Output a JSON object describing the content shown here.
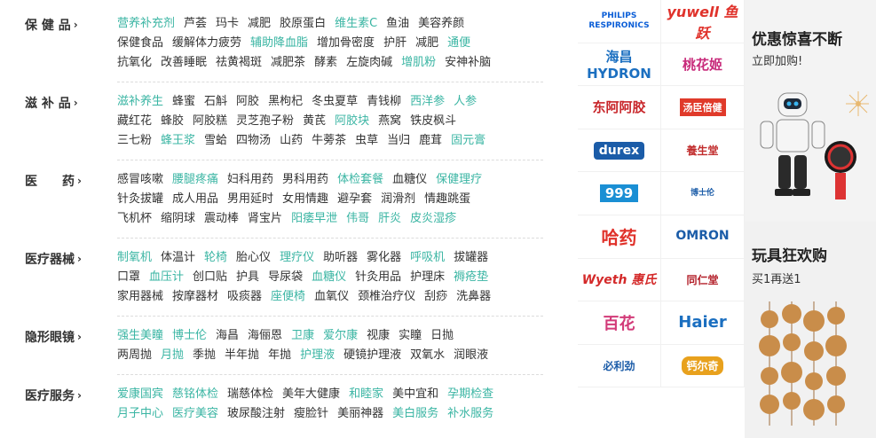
{
  "categories": [
    {
      "title": "保 健 品",
      "lines": [
        [
          {
            "t": "营养补充剂",
            "h": true
          },
          {
            "t": "芦荟"
          },
          {
            "t": "玛卡"
          },
          {
            "t": "减肥"
          },
          {
            "t": "胶原蛋白"
          },
          {
            "t": "维生素C",
            "h": true
          },
          {
            "t": "鱼油"
          },
          {
            "t": "美容养颜"
          }
        ],
        [
          {
            "t": "保健食品"
          },
          {
            "t": "缓解体力疲劳"
          },
          {
            "t": "辅助降血脂",
            "h": true
          },
          {
            "t": "增加骨密度"
          },
          {
            "t": "护肝"
          },
          {
            "t": "减肥"
          },
          {
            "t": "通便",
            "h": true
          }
        ],
        [
          {
            "t": "抗氧化"
          },
          {
            "t": "改善睡眠"
          },
          {
            "t": "祛黄褐斑"
          },
          {
            "t": "减肥茶"
          },
          {
            "t": "酵素"
          },
          {
            "t": "左旋肉碱"
          },
          {
            "t": "增肌粉",
            "h": true
          },
          {
            "t": "安神补脑"
          }
        ]
      ]
    },
    {
      "title": "滋 补 品",
      "lines": [
        [
          {
            "t": "滋补养生",
            "h": true
          },
          {
            "t": "蜂蜜"
          },
          {
            "t": "石斛"
          },
          {
            "t": "阿胶"
          },
          {
            "t": "黑枸杞"
          },
          {
            "t": "冬虫夏草"
          },
          {
            "t": "青钱柳"
          },
          {
            "t": "西洋参",
            "h": true
          },
          {
            "t": "人参",
            "h": true
          }
        ],
        [
          {
            "t": "藏红花"
          },
          {
            "t": "蜂胶"
          },
          {
            "t": "阿胶糕"
          },
          {
            "t": "灵芝孢子粉"
          },
          {
            "t": "黄芪"
          },
          {
            "t": "阿胶块",
            "h": true
          },
          {
            "t": "燕窝"
          },
          {
            "t": "铁皮枫斗"
          }
        ],
        [
          {
            "t": "三七粉"
          },
          {
            "t": "蜂王浆",
            "h": true
          },
          {
            "t": "雪蛤"
          },
          {
            "t": "四物汤"
          },
          {
            "t": "山药"
          },
          {
            "t": "牛蒡茶"
          },
          {
            "t": "虫草"
          },
          {
            "t": "当归"
          },
          {
            "t": "鹿茸"
          },
          {
            "t": "固元膏",
            "h": true
          }
        ]
      ]
    },
    {
      "title": "医　　药",
      "lines": [
        [
          {
            "t": "感冒咳嗽"
          },
          {
            "t": "腰腿疼痛",
            "h": true
          },
          {
            "t": "妇科用药"
          },
          {
            "t": "男科用药"
          },
          {
            "t": "体检套餐",
            "h": true
          },
          {
            "t": "血糖仪"
          },
          {
            "t": "保健理疗",
            "h": true
          }
        ],
        [
          {
            "t": "针灸拔罐"
          },
          {
            "t": "成人用品"
          },
          {
            "t": "男用延时"
          },
          {
            "t": "女用情趣"
          },
          {
            "t": "避孕套"
          },
          {
            "t": "润滑剂"
          },
          {
            "t": "情趣跳蛋"
          }
        ],
        [
          {
            "t": "飞机杯"
          },
          {
            "t": "缩阴球"
          },
          {
            "t": "震动棒"
          },
          {
            "t": "肾宝片"
          },
          {
            "t": "阳痿早泄",
            "h": true
          },
          {
            "t": "伟哥",
            "h": true
          },
          {
            "t": "肝炎",
            "h": true
          },
          {
            "t": "皮炎湿疹",
            "h": true
          }
        ]
      ]
    },
    {
      "title": "医疗器械",
      "lines": [
        [
          {
            "t": "制氧机",
            "h": true
          },
          {
            "t": "体温计"
          },
          {
            "t": "轮椅",
            "h": true
          },
          {
            "t": "胎心仪"
          },
          {
            "t": "理疗仪",
            "h": true
          },
          {
            "t": "助听器"
          },
          {
            "t": "雾化器"
          },
          {
            "t": "呼吸机",
            "h": true
          },
          {
            "t": "拔罐器"
          }
        ],
        [
          {
            "t": "口罩"
          },
          {
            "t": "血压计",
            "h": true
          },
          {
            "t": "创口贴"
          },
          {
            "t": "护具"
          },
          {
            "t": "导尿袋"
          },
          {
            "t": "血糖仪",
            "h": true
          },
          {
            "t": "针灸用品"
          },
          {
            "t": "护理床"
          },
          {
            "t": "褥疮垫",
            "h": true
          }
        ],
        [
          {
            "t": "家用器械"
          },
          {
            "t": "按摩器材"
          },
          {
            "t": "吸痰器"
          },
          {
            "t": "座便椅",
            "h": true
          },
          {
            "t": "血氧仪"
          },
          {
            "t": "颈椎治疗仪"
          },
          {
            "t": "刮痧"
          },
          {
            "t": "洗鼻器"
          }
        ]
      ]
    },
    {
      "title": "隐形眼镜",
      "lines": [
        [
          {
            "t": "强生美瞳",
            "h": true
          },
          {
            "t": "博士伦",
            "h": true
          },
          {
            "t": "海昌"
          },
          {
            "t": "海俪恩"
          },
          {
            "t": "卫康",
            "h": true
          },
          {
            "t": "爱尔康",
            "h": true
          },
          {
            "t": "视康"
          },
          {
            "t": "实瞳"
          },
          {
            "t": "日抛"
          }
        ],
        [
          {
            "t": "两周抛"
          },
          {
            "t": "月抛",
            "h": true
          },
          {
            "t": "季抛"
          },
          {
            "t": "半年抛"
          },
          {
            "t": "年抛"
          },
          {
            "t": "护理液",
            "h": true
          },
          {
            "t": "硬镜护理液"
          },
          {
            "t": "双氧水"
          },
          {
            "t": "润眼液"
          }
        ]
      ]
    },
    {
      "title": "医疗服务",
      "lines": [
        [
          {
            "t": "爱康国宾",
            "h": true
          },
          {
            "t": "慈铭体检",
            "h": true
          },
          {
            "t": "瑞慈体检"
          },
          {
            "t": "美年大健康"
          },
          {
            "t": "和睦家",
            "h": true
          },
          {
            "t": "美中宜和"
          },
          {
            "t": "孕期检查",
            "h": true
          }
        ],
        [
          {
            "t": "月子中心",
            "h": true
          },
          {
            "t": "医疗美容",
            "h": true
          },
          {
            "t": "玻尿酸注射"
          },
          {
            "t": "瘦脸针"
          },
          {
            "t": "美丽神器"
          },
          {
            "t": "美白服务",
            "h": true
          },
          {
            "t": "补水服务",
            "h": true
          }
        ]
      ]
    }
  ],
  "brands": [
    {
      "name": "philips-logo",
      "text": "PHILIPS RESPIRONICS",
      "cls": "b-philips"
    },
    {
      "name": "yuwell-logo",
      "text": "yuwell 鱼跃",
      "cls": "b-yuwell"
    },
    {
      "name": "haichang-logo",
      "text": "海昌 HYDRON",
      "cls": "b-haichang"
    },
    {
      "name": "taohua-logo",
      "text": "桃花姬",
      "cls": "b-taohua"
    },
    {
      "name": "dongeejiao-logo",
      "text": "东阿阿胶",
      "cls": "b-dongeejiao"
    },
    {
      "name": "by-health-logo",
      "text": "汤臣倍健",
      "cls": "b-tangchen"
    },
    {
      "name": "durex-logo",
      "text": "durex",
      "cls": "b-durex"
    },
    {
      "name": "yangshengtang-logo",
      "text": "養生堂",
      "cls": "b-yangsheng"
    },
    {
      "name": "999-logo",
      "text": "999",
      "cls": "b-999"
    },
    {
      "name": "bausch-lomb-logo",
      "text": "博士伦",
      "cls": "b-bausch"
    },
    {
      "name": "haoyao-logo",
      "text": "哈药",
      "cls": "b-haoyao"
    },
    {
      "name": "omron-logo",
      "text": "OMRON",
      "cls": "b-omron"
    },
    {
      "name": "wyeth-logo",
      "text": "Wyeth 惠氏",
      "cls": "b-wyeth"
    },
    {
      "name": "tongrentang-logo",
      "text": "同仁堂",
      "cls": "b-tongren"
    },
    {
      "name": "baihua-logo",
      "text": "百花",
      "cls": "b-baihua"
    },
    {
      "name": "haier-logo",
      "text": "Haier",
      "cls": "b-haier"
    },
    {
      "name": "bilisheng-logo",
      "text": "必利劲",
      "cls": "b-bilisheng"
    },
    {
      "name": "caltrate-logo",
      "text": "钙尔奇",
      "cls": "b-caltrate"
    }
  ],
  "promo": {
    "top_title": "优惠惊喜不断",
    "top_sub": "立即加购!",
    "bottom_title": "玩具狂欢购",
    "bottom_sub": "买1再送1"
  }
}
